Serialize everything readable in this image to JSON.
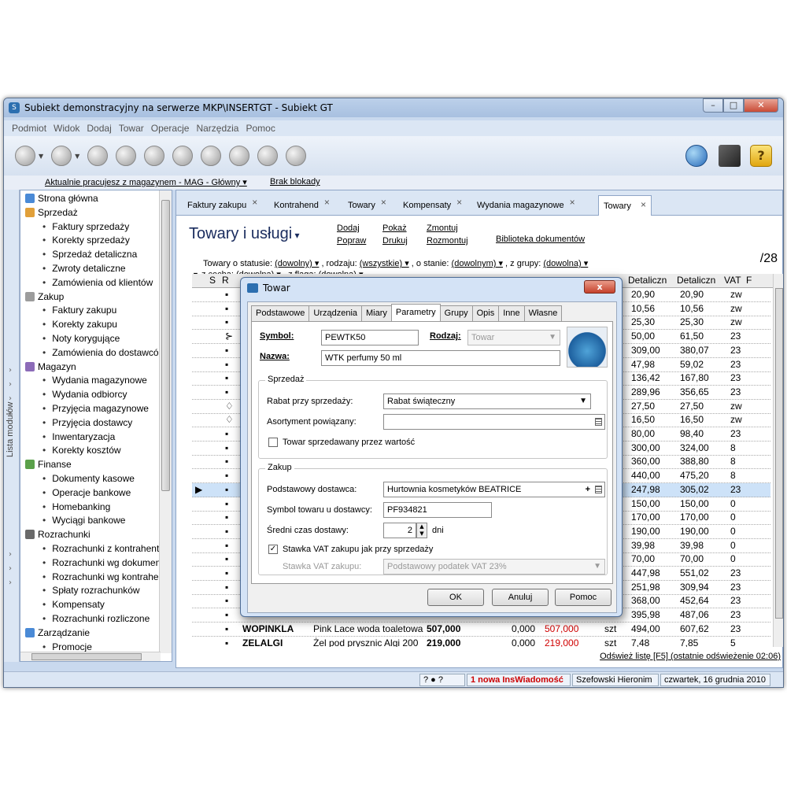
{
  "window": {
    "title": "Subiekt demonstracyjny na serwerze MKP\\INSERTGT - Subiekt GT",
    "min": "–",
    "max": "□",
    "close": "✕"
  },
  "menu": [
    "Podmiot",
    "Widok",
    "Dodaj",
    "Towar",
    "Operacje",
    "Narzędzia",
    "Pomoc"
  ],
  "infobar": {
    "warehouse": "Aktualnie pracujesz z magazynem - MAG - Główny ▾",
    "lock": "Brak blokady"
  },
  "sidebar": {
    "vertical_label": "Lista modułów",
    "items": [
      {
        "type": "group",
        "label": "Strona główna"
      },
      {
        "type": "group",
        "label": "Sprzedaż"
      },
      {
        "type": "child",
        "label": "Faktury sprzedaży"
      },
      {
        "type": "child",
        "label": "Korekty sprzedaży"
      },
      {
        "type": "child",
        "label": "Sprzedaż detaliczna"
      },
      {
        "type": "child",
        "label": "Zwroty detaliczne"
      },
      {
        "type": "child",
        "label": "Zamówienia od klientów"
      },
      {
        "type": "group",
        "label": "Zakup"
      },
      {
        "type": "child",
        "label": "Faktury zakupu"
      },
      {
        "type": "child",
        "label": "Korekty zakupu"
      },
      {
        "type": "child",
        "label": "Noty korygujące"
      },
      {
        "type": "child",
        "label": "Zamówienia do dostawcó"
      },
      {
        "type": "group",
        "label": "Magazyn"
      },
      {
        "type": "child",
        "label": "Wydania magazynowe"
      },
      {
        "type": "child",
        "label": "Wydania odbiorcy"
      },
      {
        "type": "child",
        "label": "Przyjęcia magazynowe"
      },
      {
        "type": "child",
        "label": "Przyjęcia dostawcy"
      },
      {
        "type": "child",
        "label": "Inwentaryzacja"
      },
      {
        "type": "child",
        "label": "Korekty kosztów"
      },
      {
        "type": "group",
        "label": "Finanse"
      },
      {
        "type": "child",
        "label": "Dokumenty kasowe"
      },
      {
        "type": "child",
        "label": "Operacje bankowe"
      },
      {
        "type": "child",
        "label": "Homebanking"
      },
      {
        "type": "child",
        "label": "Wyciągi bankowe"
      },
      {
        "type": "group",
        "label": "Rozrachunki"
      },
      {
        "type": "child",
        "label": "Rozrachunki z kontrahente"
      },
      {
        "type": "child",
        "label": "Rozrachunki wg dokumen"
      },
      {
        "type": "child",
        "label": "Rozrachunki wg kontraher"
      },
      {
        "type": "child",
        "label": "Spłaty rozrachunków"
      },
      {
        "type": "child",
        "label": "Kompensaty"
      },
      {
        "type": "child",
        "label": "Rozrachunki rozliczone"
      },
      {
        "type": "group",
        "label": "Zarządzanie"
      },
      {
        "type": "child",
        "label": "Promocje"
      },
      {
        "type": "child",
        "label": "Cenniki"
      }
    ]
  },
  "tabs": [
    "Faktury zakupu",
    "Kontrahend",
    "Towary",
    "Kompensaty",
    "Wydania magazynowe",
    "Towary"
  ],
  "page": {
    "title": "Towary i usługi",
    "actions": {
      "dodaj": "Dodaj",
      "popraw": "Popraw",
      "pokaz": "Pokaż",
      "drukuj": "Drukuj",
      "zmontuj": "Zmontuj",
      "rozmontuj": "Rozmontuj",
      "biblioteka": "Biblioteka dokumentów"
    },
    "filter1_a": "Towary o statusie:",
    "filter1_b": "(dowolny) ▾",
    "filter1_c": ", rodzaju:",
    "filter1_d": "(wszystkie) ▾",
    "filter1_e": ", o stanie:",
    "filter1_f": "(dowolnym) ▾",
    "filter1_g": ", z grupy:",
    "filter1_h": "(dowolna) ▾",
    "filter2_a": "z cechą:",
    "filter2_b": "(dowolna) ▾",
    "filter2_c": ", z flagą:",
    "filter2_d": "(dowolna) ▾",
    "count": "/28",
    "refresh": "Odśwież listę [F5] (ostatnie odświeżenie 02:06)"
  },
  "grid": {
    "headers": {
      "s": "S",
      "r": "R",
      "det1": "Detaliczn",
      "det2": "Detaliczn",
      "vat": "VAT",
      "f": "F"
    },
    "rows": [
      {
        "sym": "▪",
        "det1": "20,90",
        "det2": "20,90",
        "vat": "zw"
      },
      {
        "sym": "▪",
        "det1": "10,56",
        "det2": "10,56",
        "vat": "zw"
      },
      {
        "sym": "▪",
        "det1": "25,30",
        "det2": "25,30",
        "vat": "zw"
      },
      {
        "sym": "⊱",
        "det1": "50,00",
        "det2": "61,50",
        "vat": "23"
      },
      {
        "sym": "▪",
        "det1": "309,00",
        "det2": "380,07",
        "vat": "23"
      },
      {
        "sym": "▪",
        "det1": "47,98",
        "det2": "59,02",
        "vat": "23"
      },
      {
        "sym": "▪",
        "det1": "136,42",
        "det2": "167,80",
        "vat": "23"
      },
      {
        "sym": "▪",
        "det1": "289,96",
        "det2": "356,65",
        "vat": "23"
      },
      {
        "sym": "♢",
        "det1": "27,50",
        "det2": "27,50",
        "vat": "zw"
      },
      {
        "sym": "♢",
        "det1": "16,50",
        "det2": "16,50",
        "vat": "zw"
      },
      {
        "sym": "▪",
        "det1": "80,00",
        "det2": "98,40",
        "vat": "23"
      },
      {
        "sym": "▪",
        "det1": "300,00",
        "det2": "324,00",
        "vat": "8"
      },
      {
        "sym": "▪",
        "det1": "360,00",
        "det2": "388,80",
        "vat": "8"
      },
      {
        "sym": "▪",
        "det1": "440,00",
        "det2": "475,20",
        "vat": "8"
      },
      {
        "sym": "▪",
        "det1": "247,98",
        "det2": "305,02",
        "vat": "23"
      },
      {
        "sym": "▪",
        "det1": "150,00",
        "det2": "150,00",
        "vat": "0"
      },
      {
        "sym": "▪",
        "det1": "170,00",
        "det2": "170,00",
        "vat": "0"
      },
      {
        "sym": "▪",
        "det1": "190,00",
        "det2": "190,00",
        "vat": "0"
      },
      {
        "sym": "▪",
        "det1": "39,98",
        "det2": "39,98",
        "vat": "0"
      },
      {
        "sym": "▪",
        "det1": "70,00",
        "det2": "70,00",
        "vat": "0"
      },
      {
        "sym": "▪",
        "det1": "447,98",
        "det2": "551,02",
        "vat": "23"
      },
      {
        "sym": "▪",
        "det1": "251,98",
        "det2": "309,94",
        "vat": "23"
      },
      {
        "sym": "▪",
        "det1": "368,00",
        "det2": "452,64",
        "vat": "23"
      },
      {
        "sym": "▪",
        "det1": "395,98",
        "det2": "487,06",
        "vat": "23"
      },
      {
        "sym": "▪",
        "code": "WOPINKLA",
        "name": "Pink Lace woda toaletowa",
        "stock": "507,000",
        "res": "0,000",
        "avail": "507,000",
        "unit": "szt",
        "det1": "494,00",
        "det2": "607,62",
        "vat": "23"
      },
      {
        "sym": "▪",
        "code": "ZELALGI",
        "name": "Żel pod prysznic Algi 200",
        "stock": "219,000",
        "res": "0,000",
        "avail": "219,000",
        "unit": "szt",
        "det1": "7,48",
        "det2": "7,85",
        "vat": "5"
      }
    ],
    "selected_index": 14,
    "selected_marker": "▶"
  },
  "status": {
    "notice": "1 nowa InsWiadomość",
    "user": "Szefowski Hieronim",
    "date": "czwartek, 16 grudnia 2010"
  },
  "dialog": {
    "title": "Towar",
    "close": "x",
    "tabs": [
      "Podstawowe",
      "Urządzenia",
      "Miary",
      "Parametry",
      "Grupy",
      "Opis",
      "Inne",
      "Własne"
    ],
    "symbol_label": "Symbol:",
    "symbol_value": "PEWTK50",
    "rodzaj_label": "Rodzaj:",
    "rodzaj_value": "Towar",
    "nazwa_label": "Nazwa:",
    "nazwa_value": "WTK perfumy 50 ml",
    "sprzedaz_group": "Sprzedaż",
    "rabat_label": "Rabat przy sprzedaży:",
    "rabat_value": "Rabat świąteczny",
    "asort_label": "Asortyment powiązany:",
    "wartosc_label": "Towar sprzedawany przez wartość",
    "zakup_group": "Zakup",
    "dostawca_label": "Podstawowy dostawca:",
    "dostawca_value": "Hurtownia kosmetyków BEATRICE",
    "symbol_dost_label": "Symbol towaru u dostawcy:",
    "symbol_dost_value": "PF934821",
    "czas_label": "Średni czas dostawy:",
    "czas_value": "2",
    "czas_unit": "dni",
    "vat_check_label": "Stawka VAT zakupu jak przy sprzedaży",
    "vat_zakupu_label": "Stawka VAT zakupu:",
    "vat_zakupu_value": "Podstawowy podatek VAT 23%",
    "ok": "OK",
    "cancel": "Anuluj",
    "help": "Pomoc"
  },
  "colors": {
    "selected_row": "#cde2f8",
    "red_value": "#d00000",
    "title_blue": "#1a2c5e"
  }
}
